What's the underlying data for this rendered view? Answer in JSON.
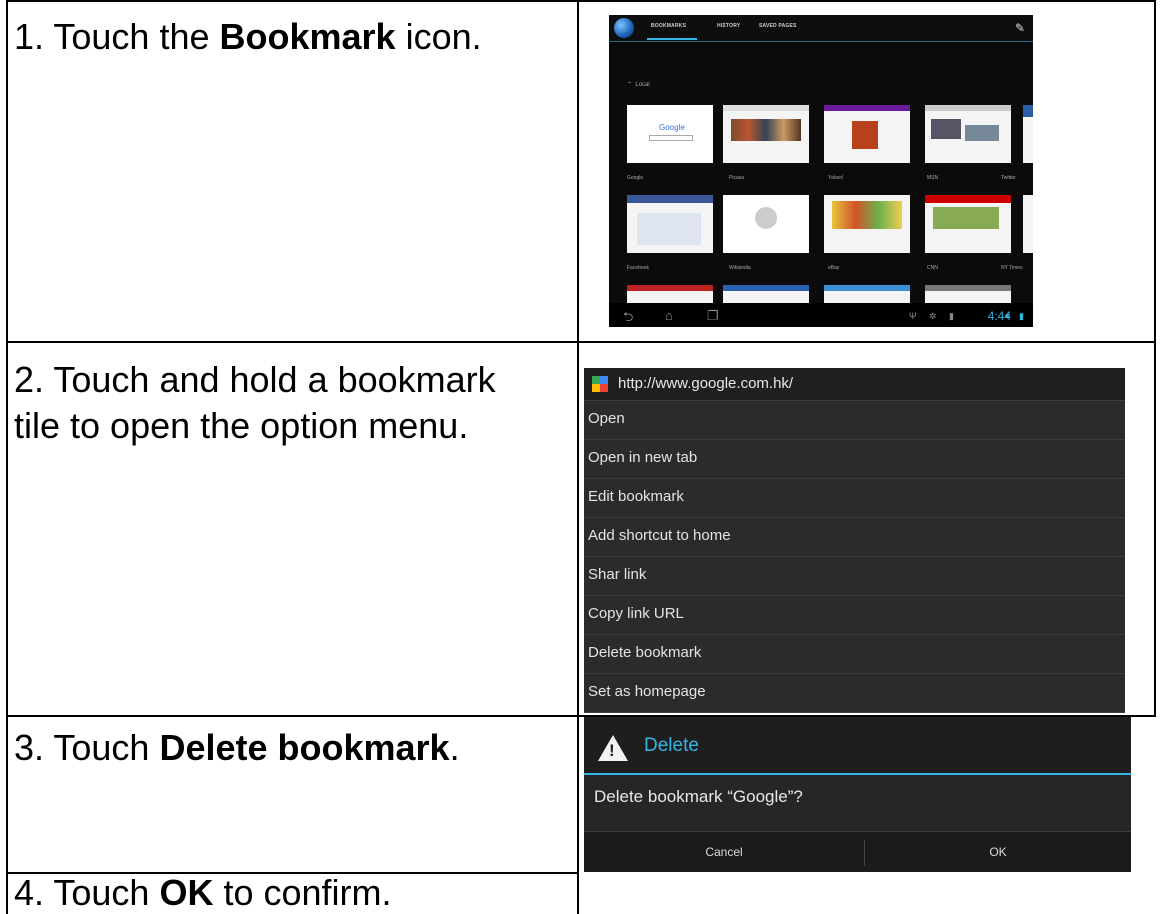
{
  "steps": [
    {
      "prefix": "1. Touch the ",
      "bold": "Bookmark",
      "suffix": " icon."
    },
    {
      "line1": "2. Touch and hold a bookmark",
      "line2": "tile to open the option menu."
    },
    {
      "prefix": "3. Touch ",
      "bold": "Delete bookmark",
      "suffix": "."
    },
    {
      "prefix": "4. Touch ",
      "bold": "OK",
      "suffix": " to confirm."
    }
  ],
  "bookmarks_screen": {
    "tabs": [
      "BOOKMARKS",
      "HISTORY",
      "SAVED PAGES"
    ],
    "section": "Local",
    "tiles": [
      "Google",
      "Picasa",
      "Yahoo!",
      "MSN",
      "Twitter",
      "Facebook",
      "Wikipedia",
      "eBay",
      "CNN",
      "NY Times"
    ],
    "clock": "4:44"
  },
  "context_menu": {
    "url": "http://www.google.com.hk/",
    "items": [
      "Open",
      "Open in new tab",
      "Edit bookmark",
      "Add shortcut to home",
      "Shar link",
      "Copy link URL",
      "Delete bookmark",
      "Set as homepage"
    ]
  },
  "delete_dialog": {
    "title": "Delete",
    "message": "Delete bookmark “Google”?",
    "cancel": "Cancel",
    "ok": "OK"
  },
  "colors": {
    "accent": "#33b5e5"
  }
}
